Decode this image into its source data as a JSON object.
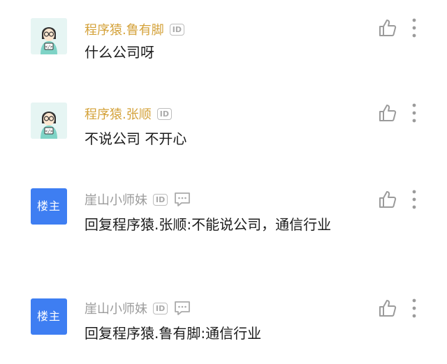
{
  "comments": [
    {
      "username": "程序猿.鲁有脚",
      "username_color": "#d4a23a",
      "id_badge": "ID",
      "avatar_type": "coder",
      "avatar_label": "",
      "content": "什么公司呀",
      "icons": [
        "coder-avatar",
        "id-badge",
        "thumbs-up-icon",
        "more-icon"
      ]
    },
    {
      "username": "程序猿.张顺",
      "username_color": "#d4a23a",
      "id_badge": "ID",
      "avatar_type": "coder",
      "avatar_label": "",
      "content": "不说公司 不开心",
      "icons": [
        "coder-avatar",
        "id-badge",
        "thumbs-up-icon",
        "more-icon"
      ]
    },
    {
      "username": "崖山小师妹",
      "username_color": "#9b9b9b",
      "id_badge": "ID",
      "avatar_type": "host",
      "avatar_label": "楼主",
      "content": "回复程序猿.张顺:不能说公司，通信行业",
      "icons": [
        "host-avatar",
        "id-badge",
        "chat-icon",
        "thumbs-up-icon",
        "more-icon"
      ]
    },
    {
      "username": "崖山小师妹",
      "username_color": "#9b9b9b",
      "id_badge": "ID",
      "avatar_type": "host",
      "avatar_label": "楼主",
      "content": "回复程序猿.鲁有脚:通信行业",
      "icons": [
        "host-avatar",
        "id-badge",
        "chat-icon",
        "thumbs-up-icon",
        "more-icon"
      ]
    }
  ],
  "colors": {
    "host_avatar_bg": "#3e7ef2",
    "coder_avatar_bg": "#e6f5f3",
    "icon_gray": "#9b9b9b",
    "text": "#1c1c1c"
  }
}
